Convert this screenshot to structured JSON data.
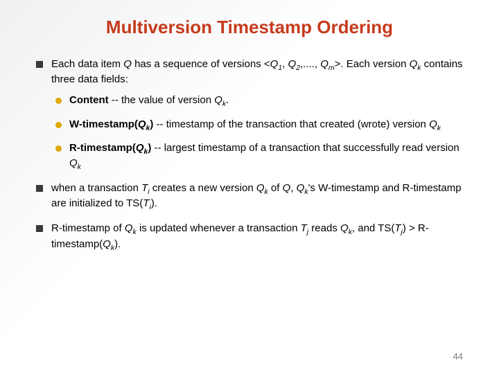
{
  "title": "Multiversion Timestamp Ordering",
  "page_number": "44",
  "bullets": {
    "b1": {
      "lead": "Each data item ",
      "q": "Q",
      "mid1": " has a sequence of versions <",
      "q1": "Q",
      "s1": "1",
      "comma1": ", ",
      "q2": "Q",
      "s2": "2",
      "dots": ",...., ",
      "qm": "Q",
      "sm": "m",
      "mid2": ">. Each version ",
      "qk": "Q",
      "sk": "k",
      "tail": " contains three data fields:"
    },
    "b1a": {
      "label": "Content",
      "mid": " -- the value of version ",
      "q": "Q",
      "s": "k",
      "dot": "."
    },
    "b1b": {
      "label": "W-timestamp",
      "open": "(",
      "q": "Q",
      "s": "k",
      "close": ")",
      "desc1": " -- timestamp of the transaction that created (wrote) version ",
      "q2": "Q",
      "s2": "k"
    },
    "b1c": {
      "label": "R-timestamp",
      "open": "(",
      "q": "Q",
      "s": "k",
      "close": ")",
      "desc1": " -- largest timestamp of a transaction that successfully read version ",
      "q2": "Q",
      "s2": "k"
    },
    "b2": {
      "t1": "when a transaction ",
      "ti": "T",
      "si": "i",
      "t2": " creates a new version ",
      "qk": "Q",
      "sk": "k",
      "t3": " of ",
      "q": "Q",
      "t4": ", ",
      "qk2": "Q",
      "sk2": "k",
      "t5": "'s W-timestamp and R-timestamp are initialized to TS(",
      "ti2": "T",
      "si2": "i",
      "t6": ")."
    },
    "b3": {
      "t1": "R-timestamp of ",
      "qk": "Q",
      "sk": "k",
      "t2": " is updated whenever a transaction ",
      "tj": "T",
      "sj": "j",
      "t3": " reads ",
      "qk2": "Q",
      "sk2": "k",
      "t4": ", and TS(",
      "tj2": "T",
      "sj2": "j",
      "t5": ") > R-timestamp(",
      "qk3": "Q",
      "sk3": "k",
      "t6": ")."
    }
  }
}
